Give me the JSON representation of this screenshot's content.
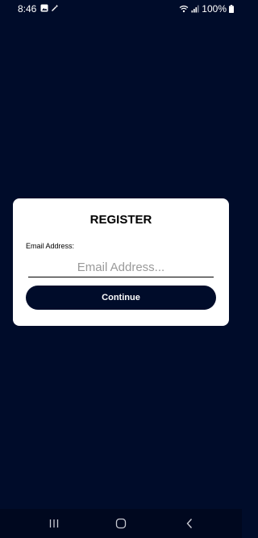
{
  "status_bar": {
    "time": "8:46",
    "battery": "100%",
    "icons": [
      "image-icon",
      "wand-icon",
      "wifi-icon",
      "signal-icon",
      "battery-icon"
    ]
  },
  "register": {
    "title": "REGISTER",
    "email_label": "Email Address:",
    "email_value": "",
    "email_placeholder": "Email Address...",
    "continue_label": "Continue"
  },
  "nav_bar": {
    "icons": [
      "recent-apps-icon",
      "home-icon",
      "back-icon"
    ]
  },
  "colors": {
    "background": "#000c2a",
    "card": "#ffffff",
    "button": "#000c2a",
    "button_text": "#ffffff"
  }
}
